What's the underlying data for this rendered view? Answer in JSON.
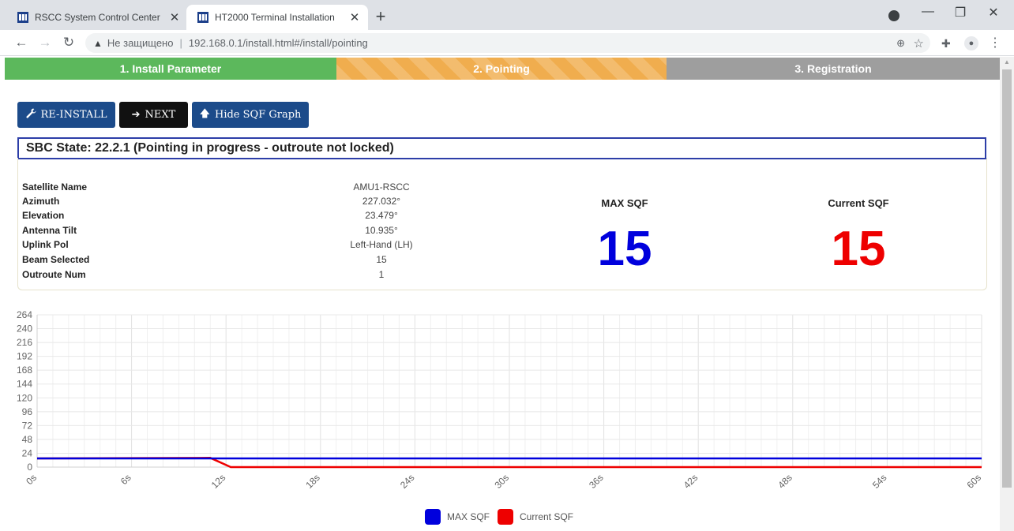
{
  "browser": {
    "tabs": [
      {
        "title": "RSCC System Control Center",
        "active": false
      },
      {
        "title": "HT2000 Terminal Installation",
        "active": true
      }
    ],
    "security_label": "Не защищено",
    "url": "192.168.0.1/install.html#/install/pointing"
  },
  "steps": [
    {
      "label": "1. Install Parameter",
      "color": "#5cb85c"
    },
    {
      "label": "2. Pointing",
      "color": "#f0ad4e"
    },
    {
      "label": "3. Registration",
      "color": "#9e9e9e"
    }
  ],
  "buttons": {
    "reinstall": "RE-INSTALL",
    "next": "NEXT",
    "hide_graph": "Hide SQF Graph"
  },
  "state_text": "SBC State: 22.2.1 (Pointing in progress - outroute not locked)",
  "info": [
    {
      "label": "Satellite Name",
      "value": "AMU1-RSCC"
    },
    {
      "label": "Azimuth",
      "value": "227.032°"
    },
    {
      "label": "Elevation",
      "value": "23.479°"
    },
    {
      "label": "Antenna Tilt",
      "value": "10.935°"
    },
    {
      "label": "Uplink Pol",
      "value": "Left-Hand (LH)"
    },
    {
      "label": "Beam Selected",
      "value": "15"
    },
    {
      "label": "Outroute Num",
      "value": "1"
    }
  ],
  "max_sqf": {
    "title": "MAX SQF",
    "value": "15",
    "color": "#0000dd"
  },
  "current_sqf": {
    "title": "Current SQF",
    "value": "15",
    "color": "#ee0000"
  },
  "chart_data": {
    "type": "line",
    "x_ticks": [
      "0s",
      "6s",
      "12s",
      "18s",
      "24s",
      "30s",
      "36s",
      "42s",
      "48s",
      "54s",
      "60s"
    ],
    "y_ticks": [
      0,
      24,
      48,
      72,
      96,
      120,
      144,
      168,
      192,
      216,
      240,
      264
    ],
    "ylim": [
      0,
      264
    ],
    "xlim": [
      0,
      60
    ],
    "grid": true,
    "legend_position": "bottom",
    "series": [
      {
        "name": "MAX SQF",
        "color": "#0000dd",
        "points": [
          [
            0,
            15
          ],
          [
            11,
            15
          ],
          [
            12,
            15
          ],
          [
            60,
            15
          ]
        ]
      },
      {
        "name": "Current SQF",
        "color": "#ee0000",
        "points": [
          [
            0,
            15
          ],
          [
            11,
            16
          ],
          [
            12.3,
            0
          ],
          [
            60,
            0
          ]
        ]
      }
    ]
  }
}
